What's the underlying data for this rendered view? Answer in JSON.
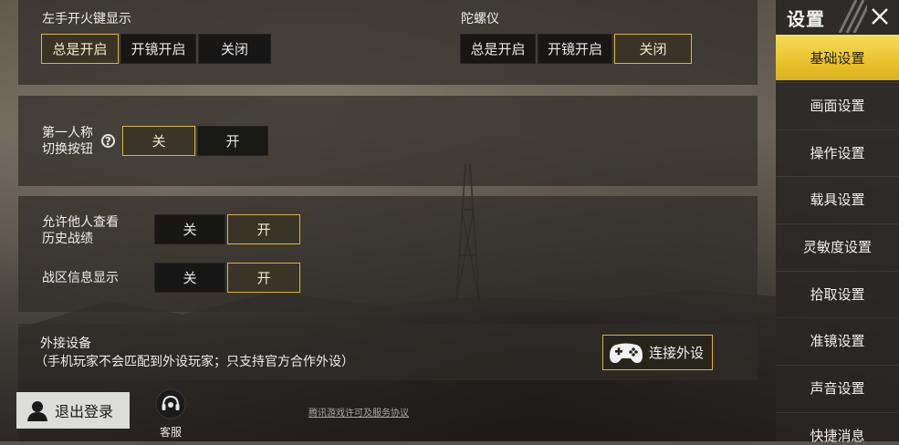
{
  "sections": {
    "fire_button": {
      "label": "左手开火键显示",
      "options": [
        "总是开启",
        "开镜开启",
        "关闭"
      ],
      "selected_index": 0
    },
    "gyroscope": {
      "label": "陀螺仪",
      "options": [
        "总是开启",
        "开镜开启",
        "关闭"
      ],
      "selected_index": 2
    },
    "first_person": {
      "label_line1": "第一人称",
      "label_line2": "切换按钮",
      "help_glyph": "?",
      "options": [
        "关",
        "开"
      ],
      "selected_index": 0
    },
    "history": {
      "label_line1": "允许他人查看",
      "label_line2": "历史战绩",
      "options": [
        "关",
        "开"
      ],
      "selected_index": 1
    },
    "battle_zone": {
      "label": "战区信息显示",
      "options": [
        "关",
        "开"
      ],
      "selected_index": 1
    },
    "peripheral": {
      "title": "外接设备",
      "note": "（手机玩家不会匹配到外设玩家；只支持官方合作外设）",
      "connect_label": "连接外设"
    }
  },
  "footer": {
    "logout_label": "退出登录",
    "service_label": "客服",
    "license_text": "腾讯游戏许可及服务协议"
  },
  "sidebar": {
    "title": "设置",
    "active_index": 0,
    "items": [
      "基础设置",
      "画面设置",
      "操作设置",
      "载具设置",
      "灵敏度设置",
      "拾取设置",
      "准镜设置",
      "声音设置",
      "快捷消息"
    ]
  },
  "colors": {
    "accent": "#d9b43a",
    "active_tab": "#f0cf40",
    "panel": "#302d28",
    "option_bg": "#121212"
  },
  "icons": [
    "help-icon",
    "gamepad-icon",
    "user-silhouette-icon",
    "headset-icon",
    "close-icon"
  ]
}
